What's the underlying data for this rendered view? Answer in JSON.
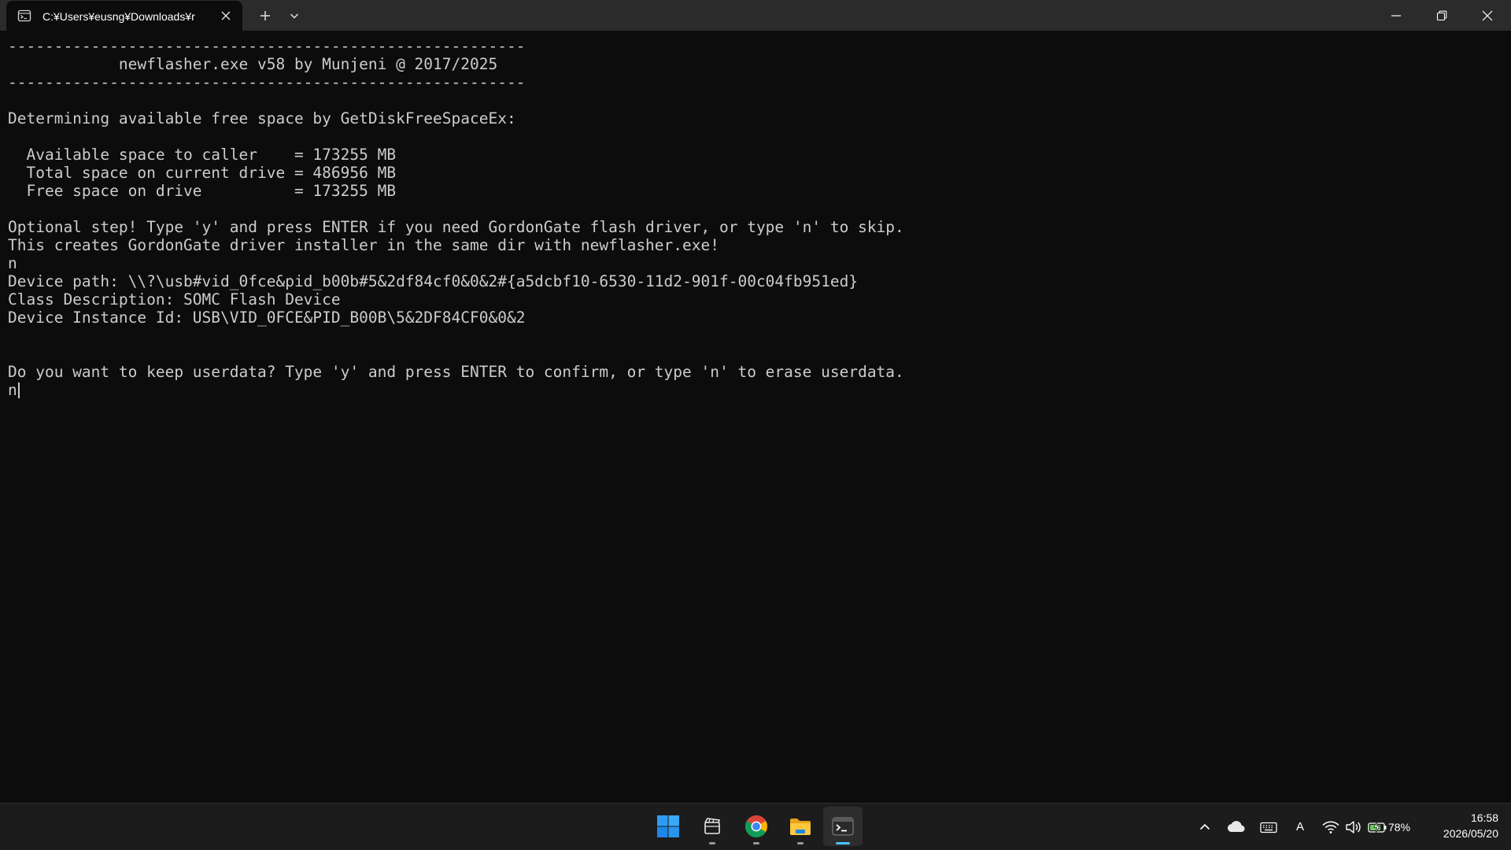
{
  "window": {
    "tab_title": "C:¥Users¥eusng¥Downloads¥r",
    "icons": {
      "tab": "terminal-tab-icon",
      "close_tab": "close-icon",
      "new_tab": "plus-icon",
      "dropdown": "chevron-down-icon",
      "minimize": "minimize-icon",
      "restore": "restore-icon",
      "close": "close-icon"
    }
  },
  "terminal": {
    "lines": [
      "--------------------------------------------------------",
      "            newflasher.exe v58 by Munjeni @ 2017/2025",
      "--------------------------------------------------------",
      "",
      "Determining available free space by GetDiskFreeSpaceEx:",
      "",
      "  Available space to caller    = 173255 MB",
      "  Total space on current drive = 486956 MB",
      "  Free space on drive          = 173255 MB",
      "",
      "Optional step! Type 'y' and press ENTER if you need GordonGate flash driver, or type 'n' to skip.",
      "This creates GordonGate driver installer in the same dir with newflasher.exe!",
      "n",
      "Device path: \\\\?\\usb#vid_0fce&pid_b00b#5&2df84cf0&0&2#{a5dcbf10-6530-11d2-901f-00c04fb951ed}",
      "Class Description: SOMC Flash Device",
      "Device Instance Id: USB\\VID_0FCE&PID_B00B\\5&2DF84CF0&0&2",
      "",
      "",
      "Do you want to keep userdata? Type 'y' and press ENTER to confirm, or type 'n' to erase userdata."
    ],
    "input_value": "n",
    "colors": {
      "background": "#0c0c0c",
      "foreground": "#cccccc"
    }
  },
  "taskbar": {
    "apps": [
      {
        "name": "start",
        "icon": "windows-logo-icon"
      },
      {
        "name": "clipchamp",
        "icon": "clapperboard-icon"
      },
      {
        "name": "chrome",
        "icon": "chrome-icon"
      },
      {
        "name": "file-explorer",
        "icon": "folder-icon"
      },
      {
        "name": "terminal",
        "icon": "terminal-icon",
        "active": true
      }
    ],
    "tray": {
      "icons": [
        "chevron-up-icon",
        "cloud-icon",
        "keyboard-icon",
        "wifi-icon",
        "speaker-icon",
        "battery-charging-icon"
      ],
      "language": "A",
      "battery_percent": "78%"
    },
    "clock": {
      "time": "16:58",
      "date": "2026/05/20"
    },
    "colors": {
      "accent": "#4cc2ff",
      "windows_blue": "#0078d4"
    }
  }
}
